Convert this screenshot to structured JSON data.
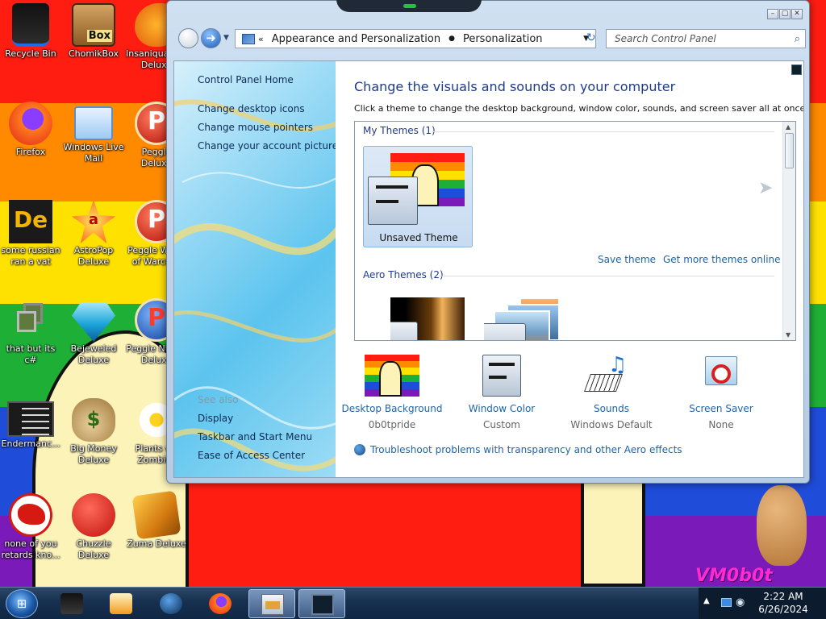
{
  "desktop": {
    "icons": [
      {
        "label": "Recycle Bin",
        "icon": "recycle-bin-icon"
      },
      {
        "label": "ChomikBox",
        "icon": "chomikbox-icon",
        "badge": "Box"
      },
      {
        "label": "Insaniquarium Deluxe",
        "icon": "fish-icon"
      },
      {
        "label": "Firefox",
        "icon": "firefox-icon"
      },
      {
        "label": "Windows Live Mail",
        "icon": "mail-icon"
      },
      {
        "label": "Peggle Deluxe",
        "icon": "peggle-icon",
        "letter": "P"
      },
      {
        "label": "some russian ran a vat",
        "icon": "de-icon",
        "letter": "De"
      },
      {
        "label": "AstroPop Deluxe",
        "icon": "astropop-icon",
        "letter": "a"
      },
      {
        "label": "Peggle World of Warcraft",
        "icon": "peggle-icon",
        "letter": "P"
      },
      {
        "label": "that but its c#",
        "icon": "copy-icon"
      },
      {
        "label": "Bejeweled Deluxe",
        "icon": "gem-icon"
      },
      {
        "label": "Peggle Nights Deluxe",
        "icon": "peggle-icon",
        "letter": "P"
      },
      {
        "label": "Endermanc...",
        "icon": "terminal-icon"
      },
      {
        "label": "Big Money Deluxe",
        "icon": "money-bag-icon",
        "letter": "$"
      },
      {
        "label": "Plants vs. Zombies",
        "icon": "flower-icon"
      },
      {
        "label": "none of you retards kno...",
        "icon": "dragon-icon"
      },
      {
        "label": "Chuzzle Deluxe",
        "icon": "chuzzle-icon"
      },
      {
        "label": "Zuma Deluxe",
        "icon": "zuma-icon"
      }
    ],
    "watermark": "VM0b0t",
    "colors": {
      "red": "#ff1d11",
      "orange": "#ff8a00",
      "yellow": "#ffe100",
      "green": "#1eb036",
      "blue": "#1f4cd9",
      "purple": "#7a1ab8"
    }
  },
  "window": {
    "controls": [
      "minimize",
      "maximize",
      "close"
    ],
    "breadcrumb": {
      "overflow": "«",
      "items": [
        "Appearance and Personalization",
        "Personalization"
      ]
    },
    "search_placeholder": "Search Control Panel",
    "left_pane": {
      "home": "Control Panel Home",
      "links": [
        "Change desktop icons",
        "Change mouse pointers",
        "Change your account picture"
      ],
      "see_also_title": "See also",
      "see_also": [
        "Display",
        "Taskbar and Start Menu",
        "Ease of Access Center"
      ]
    },
    "main": {
      "title": "Change the visuals and sounds on your computer",
      "subtitle": "Click a theme to change the desktop background, window color, sounds, and screen saver all at once.",
      "my_themes_header": "My Themes (1)",
      "selected_theme": "Unsaved Theme",
      "save_theme": "Save theme",
      "get_more": "Get more themes online",
      "aero_header": "Aero Themes (2)",
      "options": [
        {
          "title": "Desktop Background",
          "value": "0b0tpride",
          "icon": "pride-wallpaper-icon"
        },
        {
          "title": "Window Color",
          "value": "Custom",
          "icon": "window-color-icon"
        },
        {
          "title": "Sounds",
          "value": "Windows Default",
          "icon": "sounds-icon"
        },
        {
          "title": "Screen Saver",
          "value": "None",
          "icon": "screen-saver-icon"
        }
      ],
      "troubleshoot": "Troubleshoot problems with transparency and other Aero effects"
    }
  },
  "taskbar": {
    "items": [
      {
        "name": "taskbar-recycle",
        "icon": "recycle-bin-icon"
      },
      {
        "name": "taskbar-media-player",
        "icon": "media-player-icon"
      },
      {
        "name": "taskbar-media-center",
        "icon": "media-center-icon"
      },
      {
        "name": "taskbar-firefox",
        "icon": "firefox-icon"
      },
      {
        "name": "taskbar-control-panel",
        "icon": "control-panel-icon",
        "active": true
      },
      {
        "name": "taskbar-monitor",
        "icon": "monitor-icon",
        "active": true
      }
    ],
    "clock": {
      "time": "2:22 AM",
      "date": "6/26/2024"
    }
  }
}
